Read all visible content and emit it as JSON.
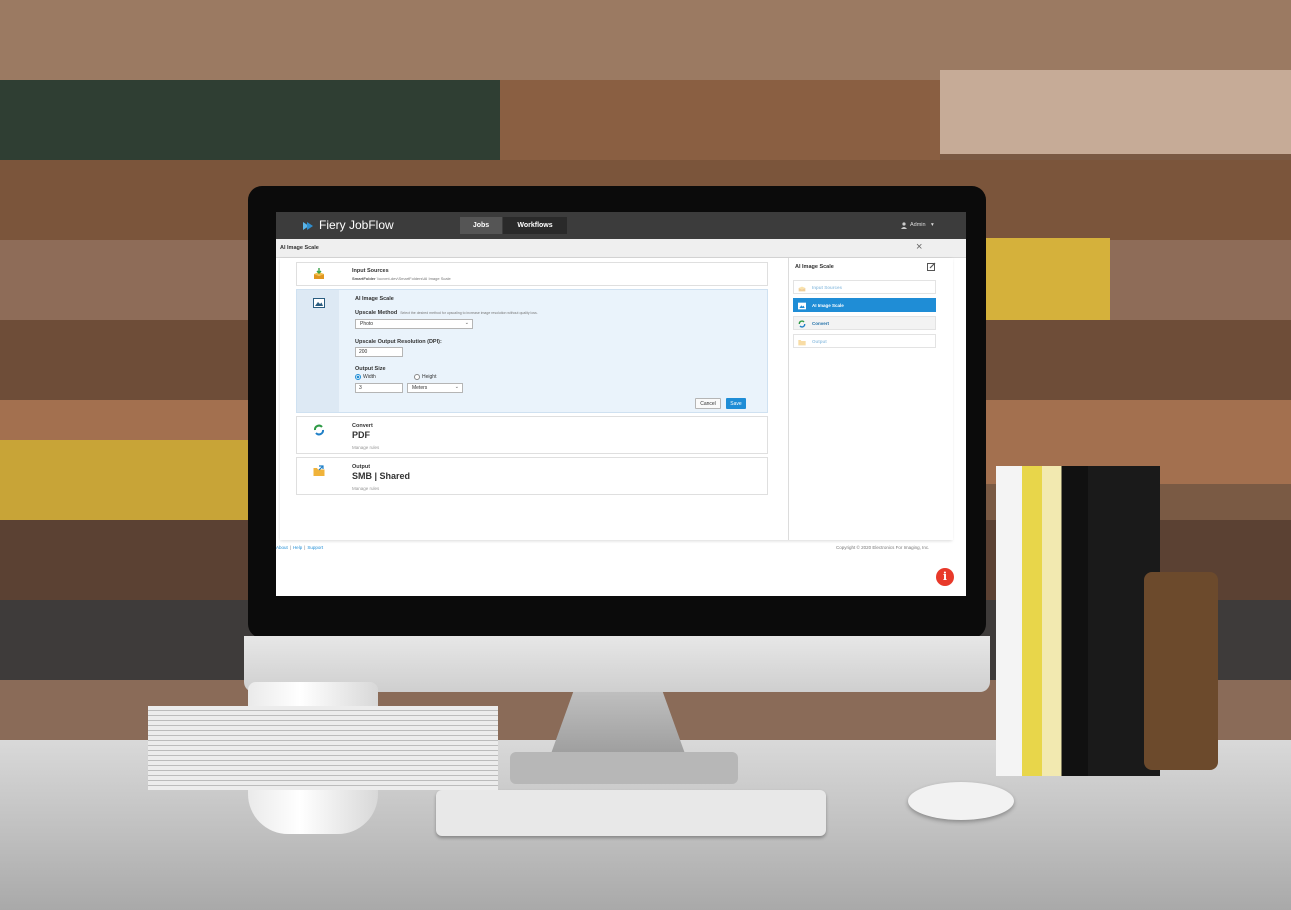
{
  "app": {
    "brand": "Fiery JobFlow"
  },
  "nav": {
    "tabs": [
      {
        "label": "Jobs"
      },
      {
        "label": "Workflows"
      }
    ]
  },
  "user": {
    "label": "Admin",
    "caret": "▾"
  },
  "dialog": {
    "title": "AI Image Scale",
    "close": "×"
  },
  "steps": {
    "input": {
      "title": "Input Sources",
      "source_type": "SmartFolder",
      "source_path": "\\\\ucvmt-dev\\SmartFolders\\AI Image Scale"
    },
    "scale": {
      "title": "AI Image Scale",
      "method_label": "Upscale Method",
      "method_hint": "Select the desired method for upscaling to increase image resolution without quality loss.",
      "method_value": "Photo",
      "resolution_label": "Upscale Output Resolution (DPI):",
      "resolution_value": "200",
      "size_label": "Output Size",
      "width_label": "Width",
      "height_label": "Height",
      "selected_dimension": "Width",
      "size_value": "3",
      "unit_value": "Meters",
      "cancel": "Cancel",
      "save": "Save"
    },
    "convert": {
      "title": "Convert",
      "value": "PDF",
      "link": "Manage rules"
    },
    "output": {
      "title": "Output",
      "value": "SMB | Shared",
      "link": "Manage rules"
    }
  },
  "sidebar": {
    "title": "AI Image Scale",
    "items": [
      {
        "label": "Input Sources",
        "state": "disabled"
      },
      {
        "label": "AI Image Scale",
        "state": "active"
      },
      {
        "label": "Convert",
        "state": "normal"
      },
      {
        "label": "Output",
        "state": "disabled"
      }
    ]
  },
  "footer": {
    "links": [
      "About",
      "Help",
      "Support"
    ],
    "separator": "|",
    "copyright": "Copyright © 2020 Electronics For Imaging, Inc."
  },
  "info_button": {
    "glyph": "i"
  },
  "colors": {
    "accent": "#1f8dd6",
    "topbar": "#3c3c3c",
    "alert": "#e8392a"
  },
  "icons": {
    "brand": "jobflow-logo-icon",
    "user": "user-icon",
    "input": "input-sources-icon",
    "scale": "image-scale-icon",
    "convert": "convert-icon",
    "output": "output-folder-icon",
    "edit": "edit-icon",
    "info": "info-icon"
  }
}
